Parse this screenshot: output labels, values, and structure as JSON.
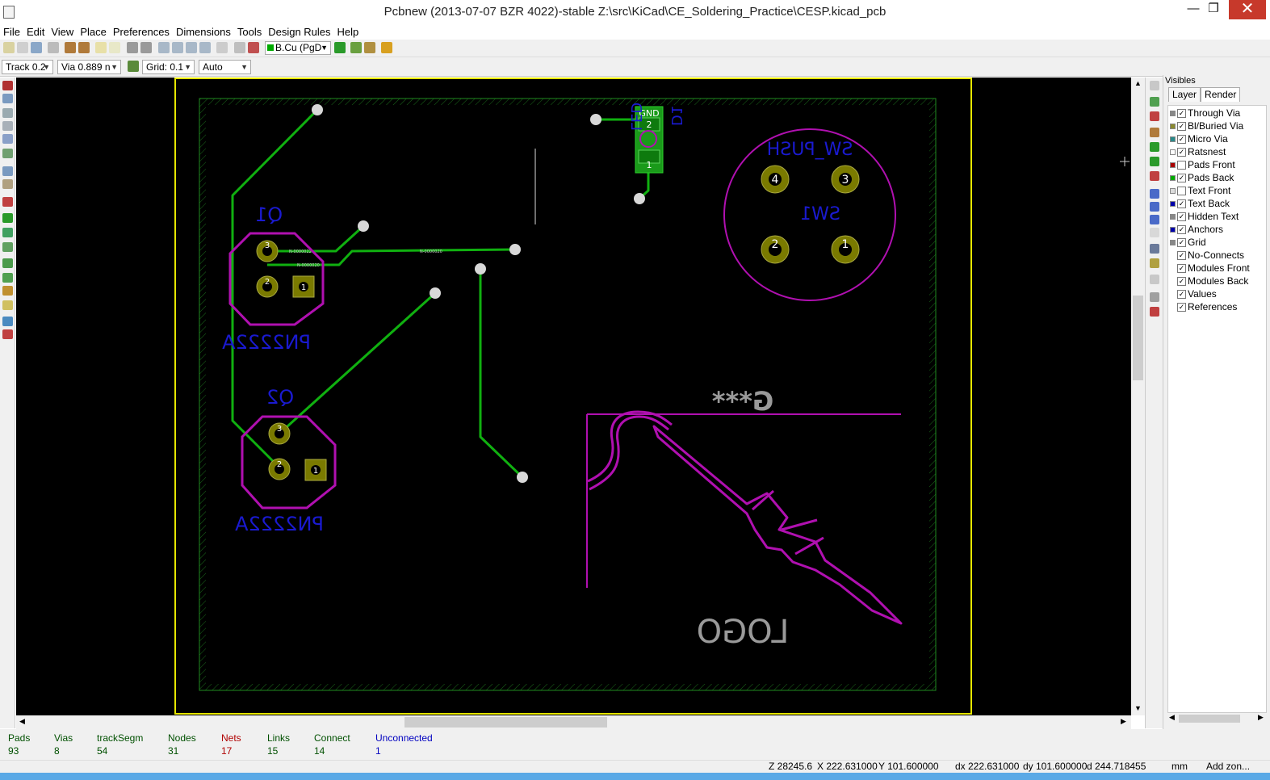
{
  "window": {
    "title": "Pcbnew (2013-07-07 BZR 4022)-stable Z:\\src\\KiCad\\CE_Soldering_Practice\\CESP.kicad_pcb",
    "minimize": "—",
    "maximize": "❐",
    "close": "✕"
  },
  "menu": [
    "File",
    "Edit",
    "View",
    "Place",
    "Preferences",
    "Dimensions",
    "Tools",
    "Design Rules",
    "Help"
  ],
  "toolbar": {
    "layer_select": "B.Cu (PgD",
    "track": "Track 0.2",
    "via": "Via 0.889 n",
    "grid": "Grid: 0.1",
    "zoom": "Auto"
  },
  "visibles": {
    "header": "Visibles",
    "tabs": [
      "Layer",
      "Render"
    ],
    "items": [
      {
        "label": "Through Via",
        "checked": true,
        "color": "#888888"
      },
      {
        "label": "Bl/Buried Via",
        "checked": true,
        "color": "#8a8a30"
      },
      {
        "label": "Micro Via",
        "checked": true,
        "color": "#2a8a8a"
      },
      {
        "label": "Ratsnest",
        "checked": true,
        "color": "#ffffff"
      },
      {
        "label": "Pads Front",
        "checked": false,
        "color": "#aa0000"
      },
      {
        "label": "Pads Back",
        "checked": true,
        "color": "#00aa00"
      },
      {
        "label": "Text Front",
        "checked": false,
        "color": "#dddddd"
      },
      {
        "label": "Text Back",
        "checked": true,
        "color": "#0000aa"
      },
      {
        "label": "Hidden Text",
        "checked": true,
        "color": "#888888"
      },
      {
        "label": "Anchors",
        "checked": true,
        "color": "#0000aa"
      },
      {
        "label": "Grid",
        "checked": true,
        "color": "#888888"
      },
      {
        "label": "No-Connects",
        "checked": true,
        "color": null
      },
      {
        "label": "Modules Front",
        "checked": true,
        "color": null
      },
      {
        "label": "Modules Back",
        "checked": true,
        "color": null
      },
      {
        "label": "Values",
        "checked": true,
        "color": null
      },
      {
        "label": "References",
        "checked": true,
        "color": null
      }
    ]
  },
  "stats": [
    {
      "label": "Pads",
      "value": "93",
      "color": "#005000"
    },
    {
      "label": "Vias",
      "value": "8",
      "color": "#005000"
    },
    {
      "label": "trackSegm",
      "value": "54",
      "color": "#005000"
    },
    {
      "label": "Nodes",
      "value": "31",
      "color": "#005000"
    },
    {
      "label": "Nets",
      "value": "17",
      "color": "#b00000"
    },
    {
      "label": "Links",
      "value": "15",
      "color": "#005000"
    },
    {
      "label": "Connect",
      "value": "14",
      "color": "#005000"
    },
    {
      "label": "Unconnected",
      "value": "1",
      "color": "#0000c0"
    }
  ],
  "coords": {
    "zoom": "Z 28245.6",
    "x": "X 222.631000",
    "y": "Y 101.600000",
    "dx": "dx 222.631000",
    "dy": "dy 101.600000",
    "d": "d 244.718455",
    "units": "mm",
    "mode": "Add zon..."
  },
  "pcb": {
    "q1_ref": "Q1",
    "q1_value": "PN2222A",
    "q2_ref": "Q2",
    "q2_value": "PN2222A",
    "sw_value": "SW_PUSH",
    "sw_ref": "SW1",
    "logo_ref": "G***",
    "logo_value": "LOGO",
    "led_net": "GND",
    "led_ref": "D1",
    "led_value": "LED",
    "pad_labels": [
      "1",
      "2",
      "3",
      "4"
    ]
  }
}
